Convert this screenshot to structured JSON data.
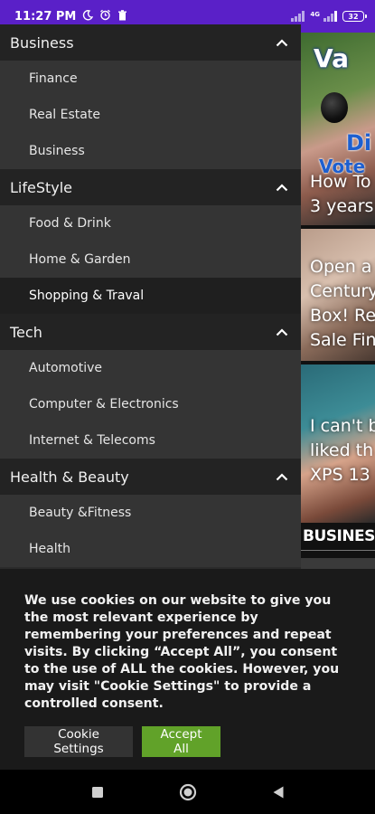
{
  "status_bar": {
    "time": "11:27 PM",
    "icons": [
      "moon-icon",
      "alarm-icon",
      "trash-icon"
    ],
    "battery": "32",
    "network_label": "4G"
  },
  "menu": {
    "sections": [
      {
        "label": "Business",
        "items": [
          "Finance",
          "Real Estate",
          "Business"
        ]
      },
      {
        "label": "LifeStyle",
        "items": [
          "Food & Drink",
          "Home & Garden",
          "Shopping & Traval"
        ]
      },
      {
        "label": "Tech",
        "items": [
          "Automotive",
          "Computer & Electronics",
          "Internet & Telecoms"
        ]
      },
      {
        "label": "Health & Beauty",
        "items": [
          "Beauty &Fitness",
          "Health"
        ]
      }
    ],
    "active_item": "Shopping & Traval"
  },
  "articles": {
    "card1": {
      "overlay_a": "Va",
      "overlay_b": "Di",
      "overlay_c": "Vote",
      "title": "How To\n3 years"
    },
    "card2": {
      "title": "Open a\nCentury\nBox! Re\nSale Fin"
    },
    "card3": {
      "title": "I can't b\nliked th\nXPS 13 "
    },
    "section_label": "BUSINESS"
  },
  "cookie": {
    "text": "We use cookies on our website to give you the most relevant experience by remembering your preferences and repeat visits. By clicking “Accept All”, you consent to the use of ALL the cookies. However, you may visit \"Cookie Settings\" to provide a controlled consent.",
    "settings_label": "Cookie Settings",
    "accept_label": "Accept All"
  },
  "colors": {
    "status_bar": "#5a20c8",
    "accept_button": "#61a229",
    "menu_category_bg": "#232323",
    "menu_item_bg": "#343434"
  },
  "nav_bar": {
    "icons": [
      "square-icon",
      "circle-icon",
      "back-triangle-icon"
    ]
  }
}
